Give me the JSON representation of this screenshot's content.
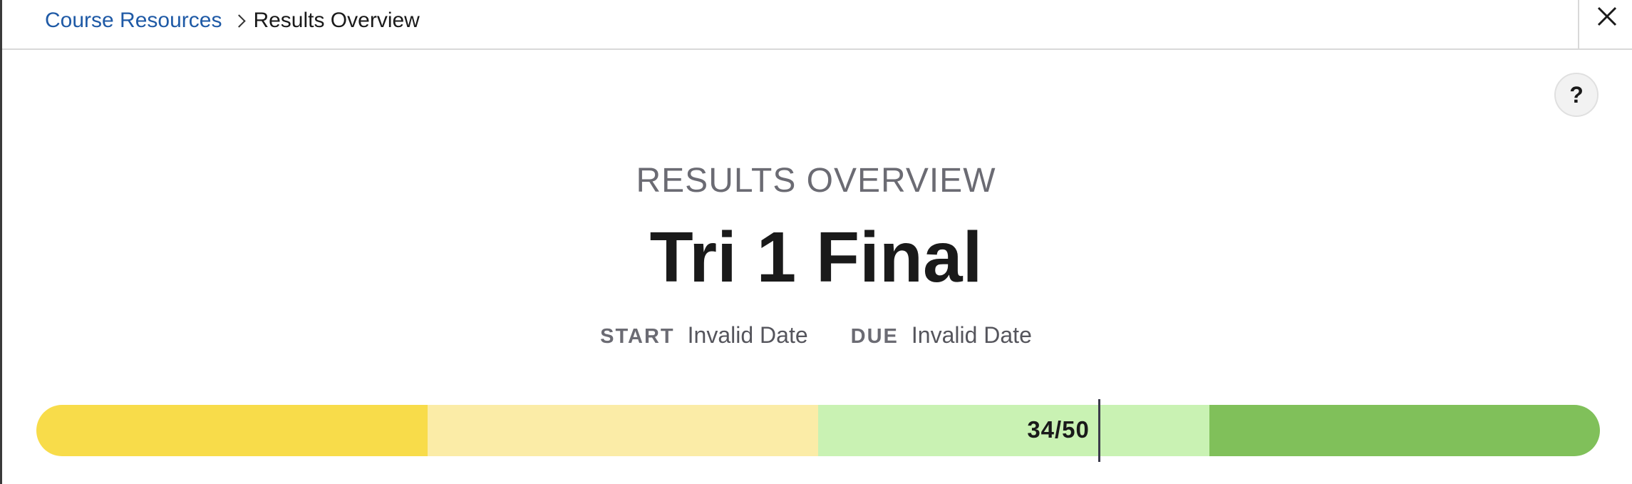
{
  "breadcrumb": {
    "parent_label": "Course Resources",
    "current_label": "Results Overview"
  },
  "header": {
    "eyebrow": "RESULTS OVERVIEW",
    "title": "Tri 1 Final"
  },
  "dates": {
    "start_label": "START",
    "start_value": "Invalid Date",
    "due_label": "DUE",
    "due_value": "Invalid Date"
  },
  "help": {
    "label": "?"
  },
  "score": {
    "text": "34/50",
    "earned": 34,
    "total": 50,
    "bands": [
      {
        "name": "band-1",
        "fraction": 0.25,
        "color": "#f8dc4a"
      },
      {
        "name": "band-2",
        "fraction": 0.25,
        "color": "#fbeca7"
      },
      {
        "name": "band-3",
        "fraction": 0.25,
        "color": "#c9f2b3"
      },
      {
        "name": "band-4",
        "fraction": 0.25,
        "color": "#80c05a"
      }
    ]
  },
  "colors": {
    "link": "#1f5aa6",
    "text_primary": "#1a1a1a",
    "text_muted": "#6b6b73"
  }
}
